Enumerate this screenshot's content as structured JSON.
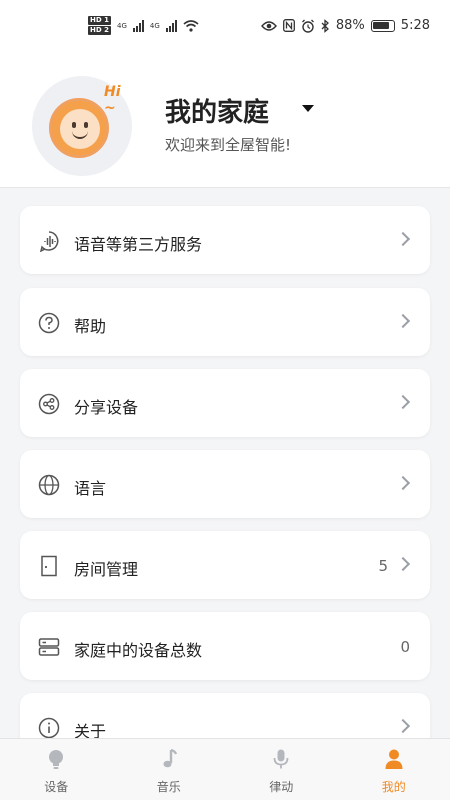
{
  "status_bar": {
    "hd1": "HD 1",
    "hd2": "HD 2",
    "net1": "4G",
    "net2": "4G",
    "battery_pct": "88%",
    "time": "5:28"
  },
  "header": {
    "avatar_text": "Hi ~",
    "family_name": "我的家庭",
    "welcome": "欢迎来到全屋智能!"
  },
  "menu": [
    {
      "label": "语音等第三方服务",
      "value": "",
      "icon": "voice-service-icon",
      "chevron": true
    },
    {
      "label": "帮助",
      "value": "",
      "icon": "help-icon",
      "chevron": true
    },
    {
      "label": "分享设备",
      "value": "",
      "icon": "share-icon",
      "chevron": true
    },
    {
      "label": "语言",
      "value": "",
      "icon": "globe-icon",
      "chevron": true
    },
    {
      "label": "房间管理",
      "value": "5",
      "icon": "door-icon",
      "chevron": true
    },
    {
      "label": "家庭中的设备总数",
      "value": "0",
      "icon": "devices-icon",
      "chevron": false
    },
    {
      "label": "关于",
      "value": "",
      "icon": "info-icon",
      "chevron": true
    }
  ],
  "bottom_nav": [
    {
      "label": "设备",
      "icon": "bulb-icon",
      "active": false
    },
    {
      "label": "音乐",
      "icon": "music-note-icon",
      "active": false
    },
    {
      "label": "律动",
      "icon": "microphone-icon",
      "active": false
    },
    {
      "label": "我的",
      "icon": "person-icon",
      "active": true
    }
  ],
  "colors": {
    "accent": "#f08a24",
    "background": "#f4f5f7",
    "card": "#ffffff"
  }
}
